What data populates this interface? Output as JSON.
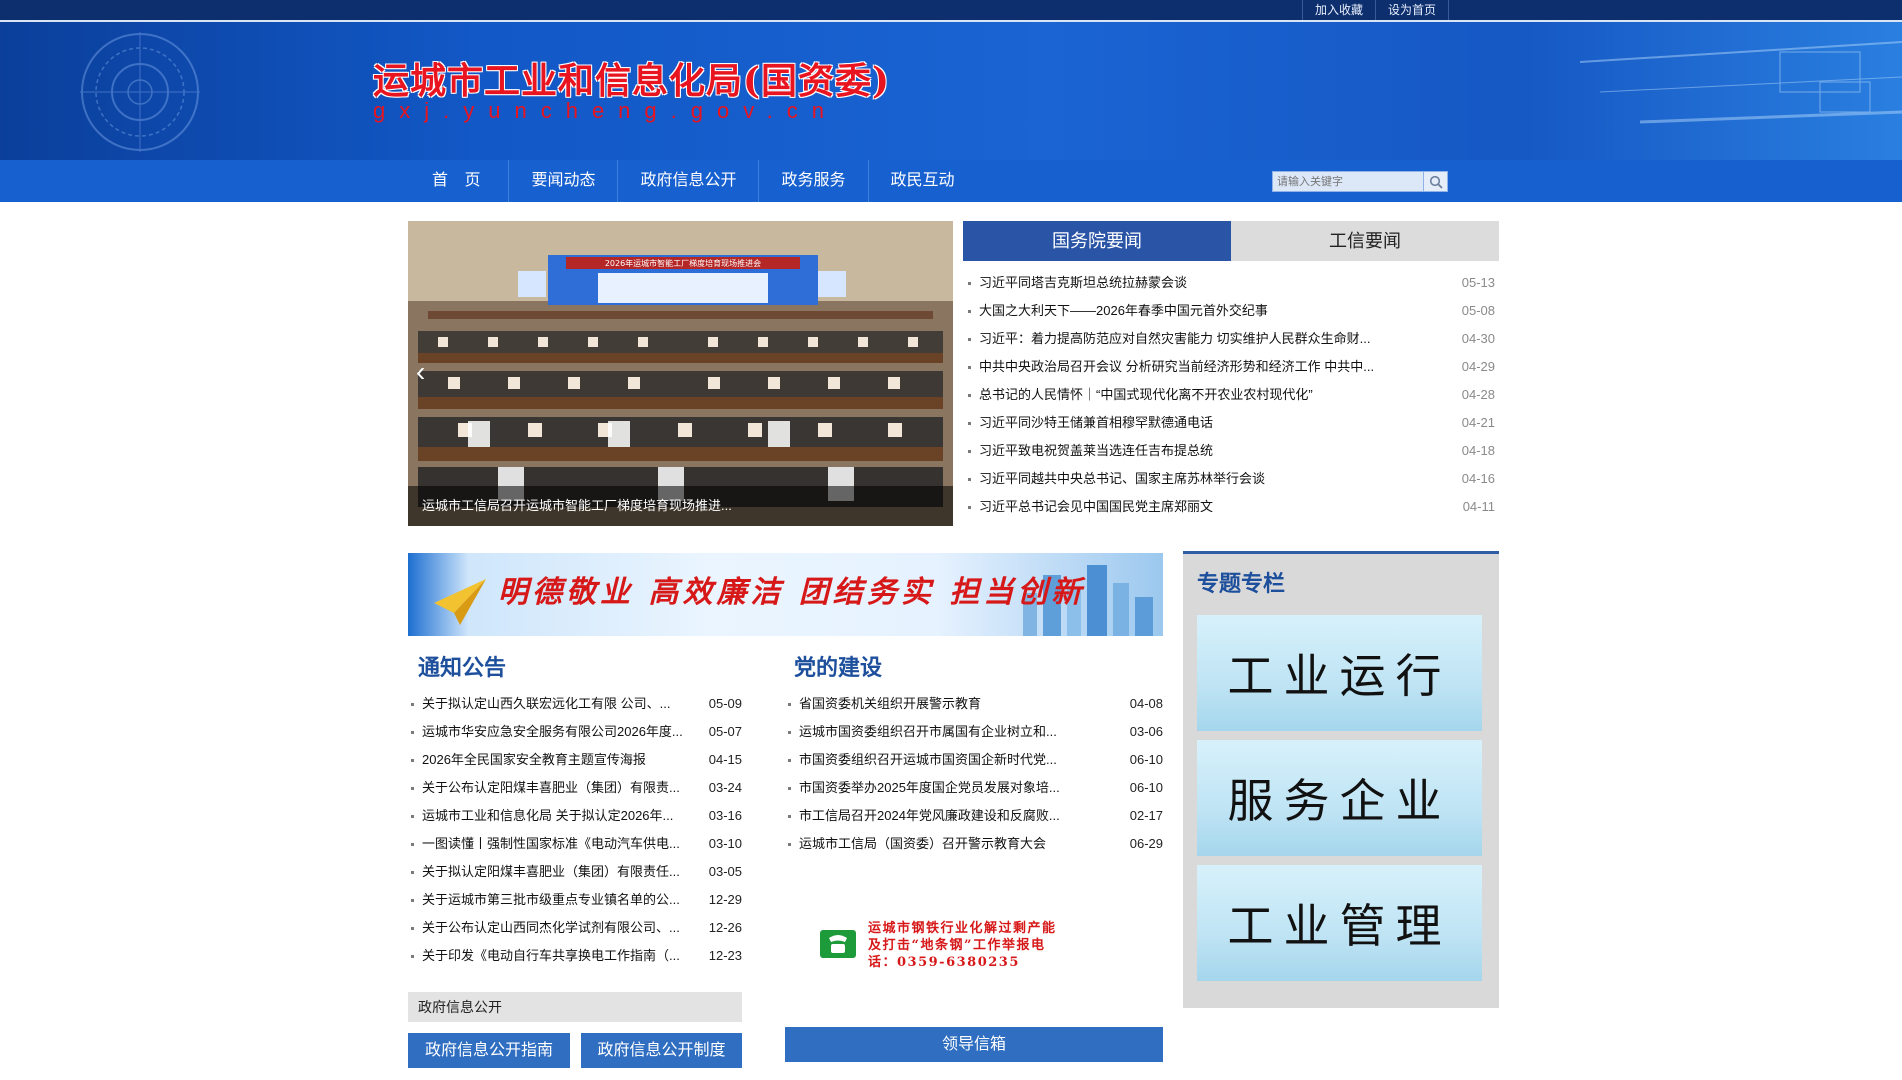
{
  "top_links": [
    "加入收藏",
    "设为首页"
  ],
  "header": {
    "title": "运城市工业和信息化局(国资委)",
    "domain": "gxj.yuncheng.gov.cn"
  },
  "nav": {
    "items": [
      "首 页",
      "要闻动态",
      "政府信息公开",
      "政务服务",
      "政民互动"
    ],
    "search_placeholder": "请输入关键字"
  },
  "slide": {
    "caption": "运城市工信局召开运城市智能工厂梯度培育现场推进...",
    "screen_banner": "2026年运城市智能工厂梯度培育现场推进会",
    "prev_arrow": "‹"
  },
  "news_tabs": {
    "tabs": [
      "国务院要闻",
      "工信要闻"
    ],
    "items": [
      {
        "title": "习近平同塔吉克斯坦总统拉赫蒙会谈",
        "date": "05-13"
      },
      {
        "title": "大国之大利天下——2026年春季中国元首外交纪事",
        "date": "05-08"
      },
      {
        "title": "习近平：着力提高防范应对自然灾害能力 切实维护人民群众生命财...",
        "date": "04-30"
      },
      {
        "title": "中共中央政治局召开会议 分析研究当前经济形势和经济工作 中共中...",
        "date": "04-29"
      },
      {
        "title": "总书记的人民情怀｜“中国式现代化离不开农业农村现代化”",
        "date": "04-28"
      },
      {
        "title": "习近平同沙特王储兼首相穆罕默德通电话",
        "date": "04-21"
      },
      {
        "title": "习近平致电祝贺盖莱当选连任吉布提总统",
        "date": "04-18"
      },
      {
        "title": "习近平同越共中央总书记、国家主席苏林举行会谈",
        "date": "04-16"
      },
      {
        "title": "习近平总书记会见中国国民党主席郑丽文",
        "date": "04-11"
      }
    ]
  },
  "motto": "明德敬业  高效廉洁  团结务实  担当创新",
  "notices": {
    "title": "通知公告",
    "items": [
      {
        "title": "关于拟认定山西久联宏远化工有限 公司、...",
        "date": "05-09"
      },
      {
        "title": "运城市华安应急安全服务有限公司2026年度...",
        "date": "05-07"
      },
      {
        "title": "2026年全民国家安全教育主题宣传海报",
        "date": "04-15"
      },
      {
        "title": "关于公布认定阳煤丰喜肥业（集团）有限责...",
        "date": "03-24"
      },
      {
        "title": "运城市工业和信息化局 关于拟认定2026年...",
        "date": "03-16"
      },
      {
        "title": "一图读懂丨强制性国家标准《电动汽车供电...",
        "date": "03-10"
      },
      {
        "title": "关于拟认定阳煤丰喜肥业（集团）有限责任...",
        "date": "03-05"
      },
      {
        "title": "关于运城市第三批市级重点专业镇名单的公...",
        "date": "12-29"
      },
      {
        "title": "关于公布认定山西同杰化学试剂有限公司、...",
        "date": "12-26"
      },
      {
        "title": "关于印发《电动自行车共享换电工作指南（...",
        "date": "12-23"
      }
    ]
  },
  "party": {
    "title": "党的建设",
    "items": [
      {
        "title": "省国资委机关组织开展警示教育",
        "date": "04-08"
      },
      {
        "title": "运城市国资委组织召开市属国有企业树立和...",
        "date": "03-06"
      },
      {
        "title": "市国资委组织召开运城市国资国企新时代党...",
        "date": "06-10"
      },
      {
        "title": "市国资委举办2025年度国企党员发展对象培...",
        "date": "06-10"
      },
      {
        "title": "市工信局召开2024年党风廉政建设和反腐败...",
        "date": "02-17"
      },
      {
        "title": "运城市工信局（国资委）召开警示教育大会",
        "date": "06-29"
      }
    ]
  },
  "hotline": {
    "line1": "运城市钢铁行业化解过剩产能",
    "line2": "及打击“地条钢”工作举报电",
    "line3": "话：0359-6380235"
  },
  "gov_info": {
    "label": "政府信息公开",
    "guide_button": "政府信息公开指南",
    "system_button": "政府信息公开制度",
    "mailbox_button": "领导信箱"
  },
  "special": {
    "title": "专题专栏",
    "cards": [
      "工业运行",
      "服务企业",
      "工业管理"
    ]
  },
  "colors": {
    "nav_blue": "#1760cf",
    "title_red": "#e8141f",
    "tab_active": "#2a55a6",
    "section_title": "#1d4f9c"
  }
}
